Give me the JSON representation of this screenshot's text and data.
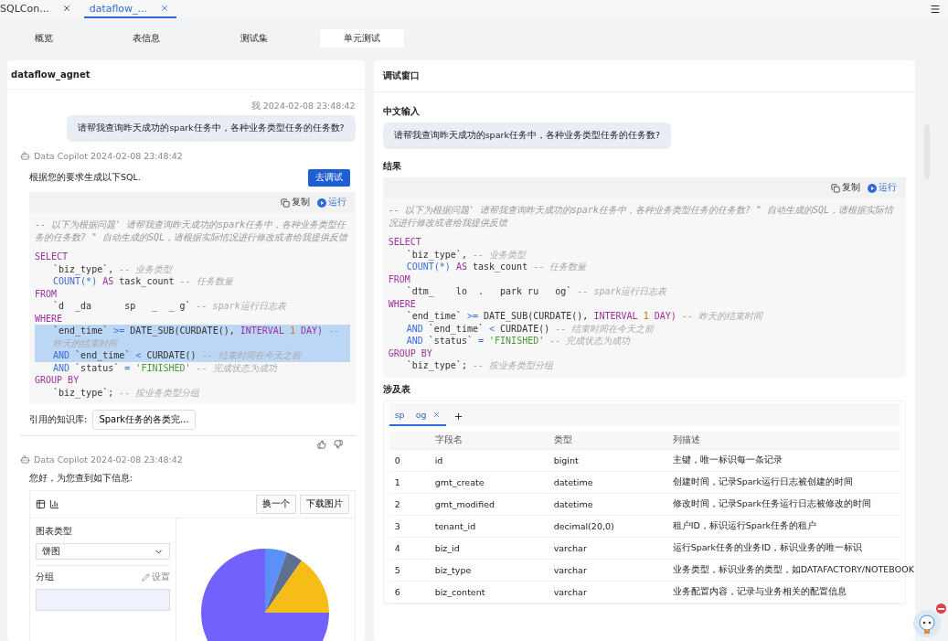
{
  "editor_tabs": [
    {
      "label": "SQLCon...",
      "selected": false
    },
    {
      "label": "dataflow_...",
      "selected": true
    }
  ],
  "view_tabs": [
    {
      "label": "概览",
      "selected": false
    },
    {
      "label": "表信息",
      "selected": false
    },
    {
      "label": "测试集",
      "selected": false
    },
    {
      "label": "单元测试",
      "selected": true
    }
  ],
  "chat": {
    "title": "dataflow_agnet",
    "messages": [
      {
        "kind": "user",
        "meta": "我 2024-02-08 23:48:42",
        "text": "请帮我查询昨天成功的spark任务中，各种业务类型任务的任务数?"
      },
      {
        "kind": "sql_answer",
        "meta": "Data Copilot 2024-02-08 23:48:42",
        "intro": "根据您的要求生成以下SQL.",
        "debug_button": "去调试",
        "copy_label": "复制",
        "run_label": "运行",
        "code": {
          "comment": "-- 以下为根据问题' 请帮我查询昨天成功的spark任务中，各种业务类型任务的任务数? \" 自动生成的SQL，请根据实际情况进行修改或者给我提供反馈",
          "lines": [
            {
              "indented": false,
              "highlighted": false,
              "tokens": [
                {
                  "text": "SELECT",
                  "kind": "kw"
                }
              ]
            },
            {
              "indented": true,
              "highlighted": false,
              "tokens": [
                {
                  "text": "`biz_type`,",
                  "kind": "txt"
                },
                {
                  "text": "-- 业务类型",
                  "kind": "cmt"
                }
              ]
            },
            {
              "indented": true,
              "highlighted": false,
              "tokens": [
                {
                  "text": "COUNT(*)",
                  "kind": "fn"
                },
                {
                  "text": "AS",
                  "kind": "kw"
                },
                {
                  "text": "task_count",
                  "kind": "txt"
                },
                {
                  "text": "-- 任务数量",
                  "kind": "cmt"
                }
              ]
            },
            {
              "indented": false,
              "highlighted": false,
              "tokens": [
                {
                  "text": "FROM",
                  "kind": "kw"
                }
              ]
            },
            {
              "indented": true,
              "highlighted": false,
              "tokens": [
                {
                  "text": "`d  _da      sp   _  _ g`",
                  "kind": "txt"
                },
                {
                  "text": "-- spark运行日志表",
                  "kind": "cmt"
                }
              ]
            },
            {
              "indented": false,
              "highlighted": false,
              "tokens": [
                {
                  "text": "WHERE",
                  "kind": "kw"
                }
              ]
            },
            {
              "indented": true,
              "highlighted": true,
              "tokens": [
                {
                  "text": "`end_time`",
                  "kind": "txt"
                },
                {
                  "text": ">=",
                  "kind": "fn"
                },
                {
                  "text": "DATE_SUB(CURDATE(),",
                  "kind": "txt"
                },
                {
                  "text": "INTERVAL",
                  "kind": "kw"
                },
                {
                  "text": "1",
                  "kind": "num"
                },
                {
                  "text": "DAY)",
                  "kind": "kw"
                },
                {
                  "text": "-- 昨天的结束时间",
                  "kind": "cmt"
                }
              ]
            },
            {
              "indented": true,
              "highlighted": true,
              "tokens": [
                {
                  "text": "AND",
                  "kind": "fn"
                },
                {
                  "text": "`end_time`",
                  "kind": "txt"
                },
                {
                  "text": "<",
                  "kind": "fn"
                },
                {
                  "text": "CURDATE()",
                  "kind": "txt"
                },
                {
                  "text": "-- 结束时间在今天之前",
                  "kind": "cmt"
                }
              ]
            },
            {
              "indented": true,
              "highlighted": false,
              "tokens": [
                {
                  "text": "AND",
                  "kind": "fn"
                },
                {
                  "text": "`status`",
                  "kind": "txt"
                },
                {
                  "text": "=",
                  "kind": "fn"
                },
                {
                  "text": "'FINISHED'",
                  "kind": "str"
                },
                {
                  "text": "-- 完成状态为成功",
                  "kind": "cmt"
                }
              ]
            },
            {
              "indented": false,
              "highlighted": false,
              "tokens": [
                {
                  "text": "GROUP BY",
                  "kind": "kw"
                }
              ]
            },
            {
              "indented": true,
              "highlighted": false,
              "tokens": [
                {
                  "text": "`biz_type`;",
                  "kind": "txt"
                },
                {
                  "text": "-- 按业务类型分组",
                  "kind": "cmt"
                }
              ]
            }
          ]
        },
        "knowledge_label": "引用的知识库:",
        "knowledge_chip": "Spark任务的各类完..."
      },
      {
        "kind": "chart_answer",
        "meta": "Data Copilot 2024-02-08 23:48:42",
        "intro": "您好，为您查到如下信息:",
        "refresh_button": "换一个",
        "download_button": "下载图片",
        "chart_type_label": "图表类型",
        "chart_type_value": "饼图",
        "group_label": "分组",
        "settings_label": "设置"
      }
    ]
  },
  "debug": {
    "title": "调试窗口",
    "input_label": "中文输入",
    "input_text": "请帮我查询昨天成功的spark任务中，各种业务类型任务的任务数?",
    "result_label": "结果",
    "copy_label": "复制",
    "run_label": "运行",
    "code": {
      "comment": "-- 以下为根据问题' 请帮我查询昨天成功的spark任务中，各种业务类型任务的任务数? \" 自动生成的SQL，请根据实际情况进行修改或者给我提供反馈",
      "lines": [
        {
          "indented": false,
          "highlighted": false,
          "tokens": [
            {
              "text": "SELECT",
              "kind": "kw"
            }
          ]
        },
        {
          "indented": true,
          "highlighted": false,
          "tokens": [
            {
              "text": "`biz_type`,",
              "kind": "txt"
            },
            {
              "text": "-- 业务类型",
              "kind": "cmt"
            }
          ]
        },
        {
          "indented": true,
          "highlighted": false,
          "tokens": [
            {
              "text": "COUNT(*)",
              "kind": "fn"
            },
            {
              "text": "AS",
              "kind": "kw"
            },
            {
              "text": "task_count",
              "kind": "txt"
            },
            {
              "text": "-- 任务数量",
              "kind": "cmt"
            }
          ]
        },
        {
          "indented": false,
          "highlighted": false,
          "tokens": [
            {
              "text": "FROM",
              "kind": "kw"
            }
          ]
        },
        {
          "indented": true,
          "highlighted": false,
          "tokens": [
            {
              "text": "`dtm_    lo  .   park ru   og`",
              "kind": "txt"
            },
            {
              "text": "-- spark运行日志表",
              "kind": "cmt"
            }
          ]
        },
        {
          "indented": false,
          "highlighted": false,
          "tokens": [
            {
              "text": "WHERE",
              "kind": "kw"
            }
          ]
        },
        {
          "indented": true,
          "highlighted": false,
          "tokens": [
            {
              "text": "`end_time`",
              "kind": "txt"
            },
            {
              "text": ">=",
              "kind": "fn"
            },
            {
              "text": "DATE_SUB(CURDATE(),",
              "kind": "txt"
            },
            {
              "text": "INTERVAL",
              "kind": "kw"
            },
            {
              "text": "1",
              "kind": "num"
            },
            {
              "text": "DAY)",
              "kind": "kw"
            },
            {
              "text": "-- 昨天的结束时间",
              "kind": "cmt"
            }
          ]
        },
        {
          "indented": true,
          "highlighted": false,
          "tokens": [
            {
              "text": "AND",
              "kind": "fn"
            },
            {
              "text": "`end_time`",
              "kind": "txt"
            },
            {
              "text": "<",
              "kind": "fn"
            },
            {
              "text": "CURDATE()",
              "kind": "txt"
            },
            {
              "text": "-- 结束时间在今天之前",
              "kind": "cmt"
            }
          ]
        },
        {
          "indented": true,
          "highlighted": false,
          "tokens": [
            {
              "text": "AND",
              "kind": "fn"
            },
            {
              "text": "`status`",
              "kind": "txt"
            },
            {
              "text": "=",
              "kind": "fn"
            },
            {
              "text": "'FINISHED'",
              "kind": "str"
            },
            {
              "text": "-- 完成状态为成功",
              "kind": "cmt"
            }
          ]
        },
        {
          "indented": false,
          "highlighted": false,
          "tokens": [
            {
              "text": "GROUP BY",
              "kind": "kw"
            }
          ]
        },
        {
          "indented": true,
          "highlighted": false,
          "tokens": [
            {
              "text": "`biz_type`;",
              "kind": "txt"
            },
            {
              "text": "-- 按业务类型分组",
              "kind": "cmt"
            }
          ]
        }
      ]
    },
    "tables_label": "涉及表",
    "table_tabs": [
      {
        "label": "sp    og",
        "selected": true
      }
    ],
    "columns": [
      "字段名",
      "类型",
      "列描述"
    ],
    "rows": [
      {
        "index": "0",
        "name": "id",
        "type": "bigint",
        "description": "主键，唯一标识每一条记录"
      },
      {
        "index": "1",
        "name": "gmt_create",
        "type": "datetime",
        "description": "创建时间，记录Spark运行日志被创建的时间"
      },
      {
        "index": "2",
        "name": "gmt_modified",
        "type": "datetime",
        "description": "修改时间，记录Spark任务运行日志被修改的时间"
      },
      {
        "index": "3",
        "name": "tenant_id",
        "type": "decimal(20,0)",
        "description": "租户ID，标识运行Spark任务的租户"
      },
      {
        "index": "4",
        "name": "biz_id",
        "type": "varchar",
        "description": "运行Spark任务的业务ID，标识业务的唯一标识"
      },
      {
        "index": "5",
        "name": "biz_type",
        "type": "varchar",
        "description": "业务类型，标识业务的类型，如DATAFACTORY/NOTEBOOK"
      },
      {
        "index": "6",
        "name": "biz_content",
        "type": "varchar",
        "description": "业务配置内容，记录与业务相关的配置信息"
      }
    ]
  }
}
